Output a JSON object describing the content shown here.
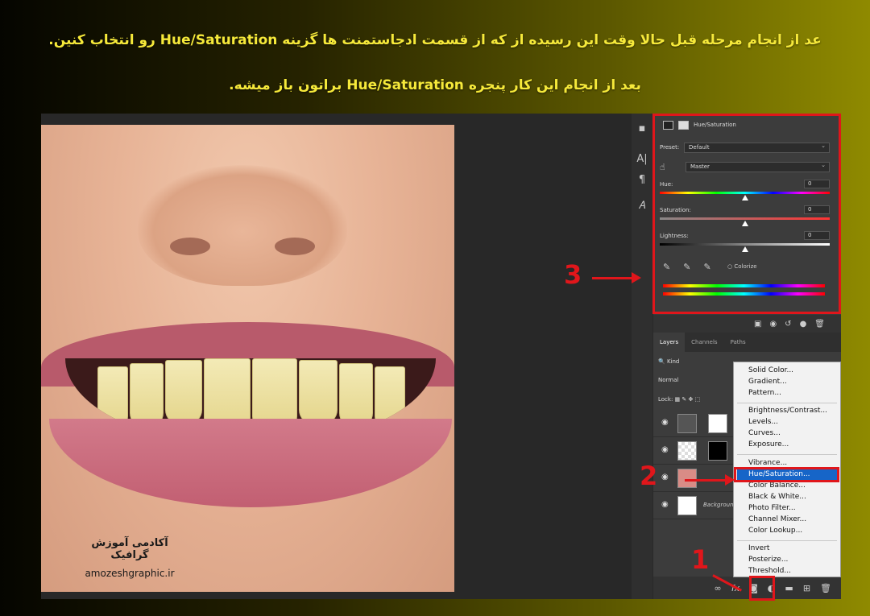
{
  "captions": {
    "line1": "عد از انجام مرحله قبل حالا وقت این رسیده از که از قسمت ادجاستمنت ها گزینه Hue/Saturation رو انتخاب کنین.",
    "line2": "بعد از انجام این کار پنجره Hue/Saturation براتون باز میشه."
  },
  "watermark": {
    "fa": "آکادمی آموزش گرافیک",
    "en": "amozeshgraphic.ir"
  },
  "properties": {
    "title": "Hue/Saturation",
    "preset_label": "Preset:",
    "preset_value": "Default",
    "channel_value": "Master",
    "hue": {
      "label": "Hue:",
      "value": "0",
      "level": 0.5
    },
    "saturation": {
      "label": "Saturation:",
      "value": "0",
      "level": 0.5
    },
    "lightness": {
      "label": "Lightness:",
      "value": "0",
      "level": 0.5
    },
    "colorize_label": "Colorize"
  },
  "layers_panel": {
    "tabs": [
      "Layers",
      "Channels",
      "Paths"
    ],
    "kind_label": "Kind",
    "blend_mode": "Normal",
    "lock_label": "Lock:",
    "background_layer": "Background",
    "bottom_icons": [
      "link-icon",
      "fx-icon",
      "mask-icon",
      "adjustment-icon",
      "folder-icon",
      "new-layer-icon",
      "trash-icon"
    ]
  },
  "adjustment_menu": {
    "group1": [
      "Solid Color...",
      "Gradient...",
      "Pattern..."
    ],
    "group2": [
      "Brightness/Contrast...",
      "Levels...",
      "Curves...",
      "Exposure..."
    ],
    "group3": [
      "Vibrance...",
      "Hue/Saturation...",
      "Color Balance...",
      "Black & White...",
      "Photo Filter...",
      "Channel Mixer...",
      "Color Lookup..."
    ],
    "group4": [
      "Invert",
      "Posterize...",
      "Threshold..."
    ]
  },
  "annotations": {
    "step1": "1",
    "step2": "2",
    "step3": "3"
  },
  "colors": {
    "caption": "#f6e93a",
    "annotation_red": "#e0161b",
    "menu_highlight": "#1665c8"
  }
}
